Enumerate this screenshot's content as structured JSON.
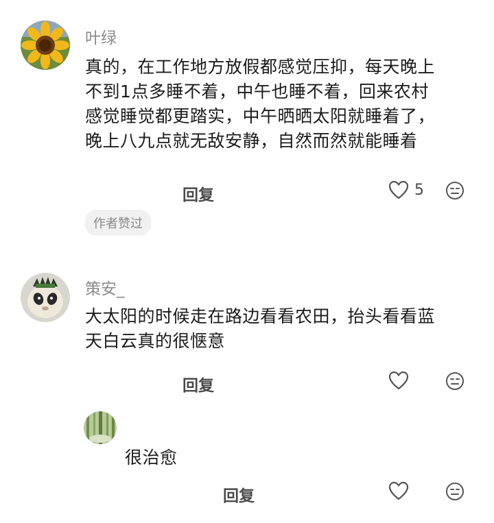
{
  "comments": [
    {
      "username": "叶绿",
      "lines": [
        "真的，在工作地方放假都感觉压抑，每天晚上",
        "不到1点多睡不着，中午也睡不着，回来农村",
        "感觉睡觉都更踏实，中午晒晒太阳就睡着了，",
        "晚上八九点就无敌安静，自然而然就能睡着"
      ],
      "reply_label": "回复",
      "like_count": "5",
      "badge": "作者赞过"
    },
    {
      "username": "策安_",
      "lines": [
        "大太阳的时候走在路边看看农田，抬头看看蓝",
        "天白云真的很惬意"
      ],
      "reply_label": "回复"
    }
  ],
  "sub_reply": {
    "text": "很治愈",
    "reply_label": "回复"
  },
  "icons": {
    "like": "heart-outline-icon",
    "more": "emoji-expressionless-icon"
  },
  "colors": {
    "username": "#8a8a8a",
    "text": "#1b1b1b",
    "badge_bg": "#f1f1f1"
  }
}
